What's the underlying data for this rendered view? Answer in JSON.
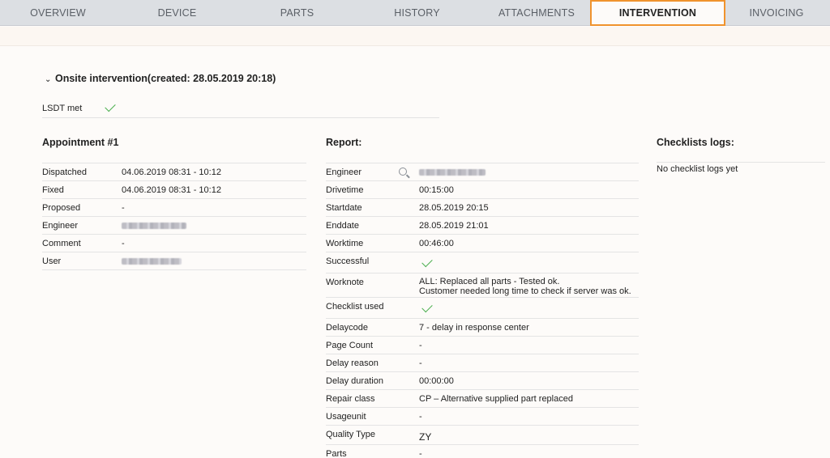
{
  "tabs": [
    {
      "label": "OVERVIEW",
      "active": false
    },
    {
      "label": "DEVICE",
      "active": false
    },
    {
      "label": "PARTS",
      "active": false
    },
    {
      "label": "HISTORY",
      "active": false
    },
    {
      "label": "ATTACHMENTS",
      "active": false
    },
    {
      "label": "INTERVENTION",
      "active": true
    },
    {
      "label": "INVOICING",
      "active": false
    }
  ],
  "section": {
    "title": "Onsite intervention(created: 28.05.2019 20:18)",
    "lsdt_label": "LSDT met"
  },
  "appointment": {
    "title": "Appointment #1",
    "rows": [
      {
        "label": "Dispatched",
        "value": "04.06.2019  08:31 - 10:12"
      },
      {
        "label": "Fixed",
        "value": "04.06.2019  08:31 - 10:12"
      },
      {
        "label": "Proposed",
        "value": "-"
      },
      {
        "label": "Engineer",
        "value": ""
      },
      {
        "label": "Comment",
        "value": "-"
      },
      {
        "label": "User",
        "value": ""
      }
    ]
  },
  "report": {
    "title": "Report:",
    "rows": [
      {
        "label": "Engineer",
        "value": ""
      },
      {
        "label": "Drivetime",
        "value": "00:15:00"
      },
      {
        "label": "Startdate",
        "value": "28.05.2019 20:15"
      },
      {
        "label": "Enddate",
        "value": "28.05.2019 21:01"
      },
      {
        "label": "Worktime",
        "value": "00:46:00"
      },
      {
        "label": "Successful",
        "value": ""
      },
      {
        "label": "Worknote",
        "value": "ALL: Replaced all parts - Tested ok.",
        "value2": "Customer needed long time to check if server was ok."
      },
      {
        "label": "Checklist used",
        "value": ""
      },
      {
        "label": "Delaycode",
        "value": "7 - delay in response center"
      },
      {
        "label": "Page Count",
        "value": "-"
      },
      {
        "label": "Delay reason",
        "value": "-"
      },
      {
        "label": "Delay duration",
        "value": "00:00:00"
      },
      {
        "label": "Repair class",
        "value": "CP – Alternative supplied part replaced"
      },
      {
        "label": "Usageunit",
        "value": "-"
      },
      {
        "label": "Quality Type",
        "value": "ZY"
      },
      {
        "label": "Parts",
        "value": "-"
      }
    ]
  },
  "checklists": {
    "title": "Checklists logs:",
    "empty_text": "No checklist logs yet"
  },
  "colors": {
    "active_tab_border": "#f0932d",
    "check": "#4caf50"
  }
}
